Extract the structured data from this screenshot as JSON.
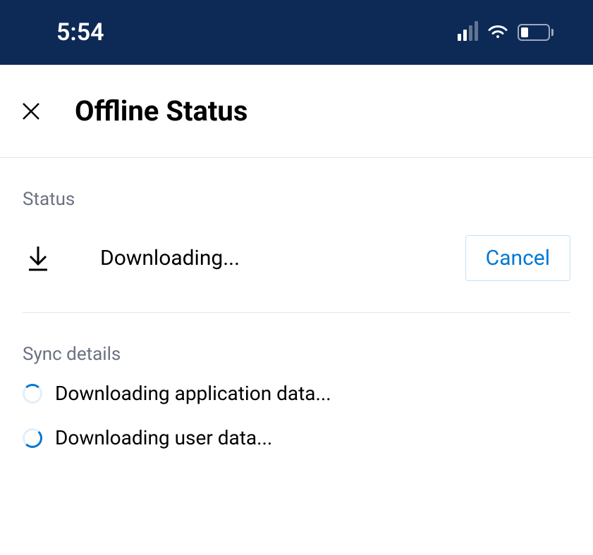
{
  "statusBar": {
    "time": "5:54"
  },
  "header": {
    "title": "Offline Status"
  },
  "status": {
    "sectionLabel": "Status",
    "text": "Downloading...",
    "cancelLabel": "Cancel"
  },
  "syncDetails": {
    "sectionLabel": "Sync details",
    "items": [
      {
        "text": "Downloading application data..."
      },
      {
        "text": "Downloading user data..."
      }
    ]
  }
}
